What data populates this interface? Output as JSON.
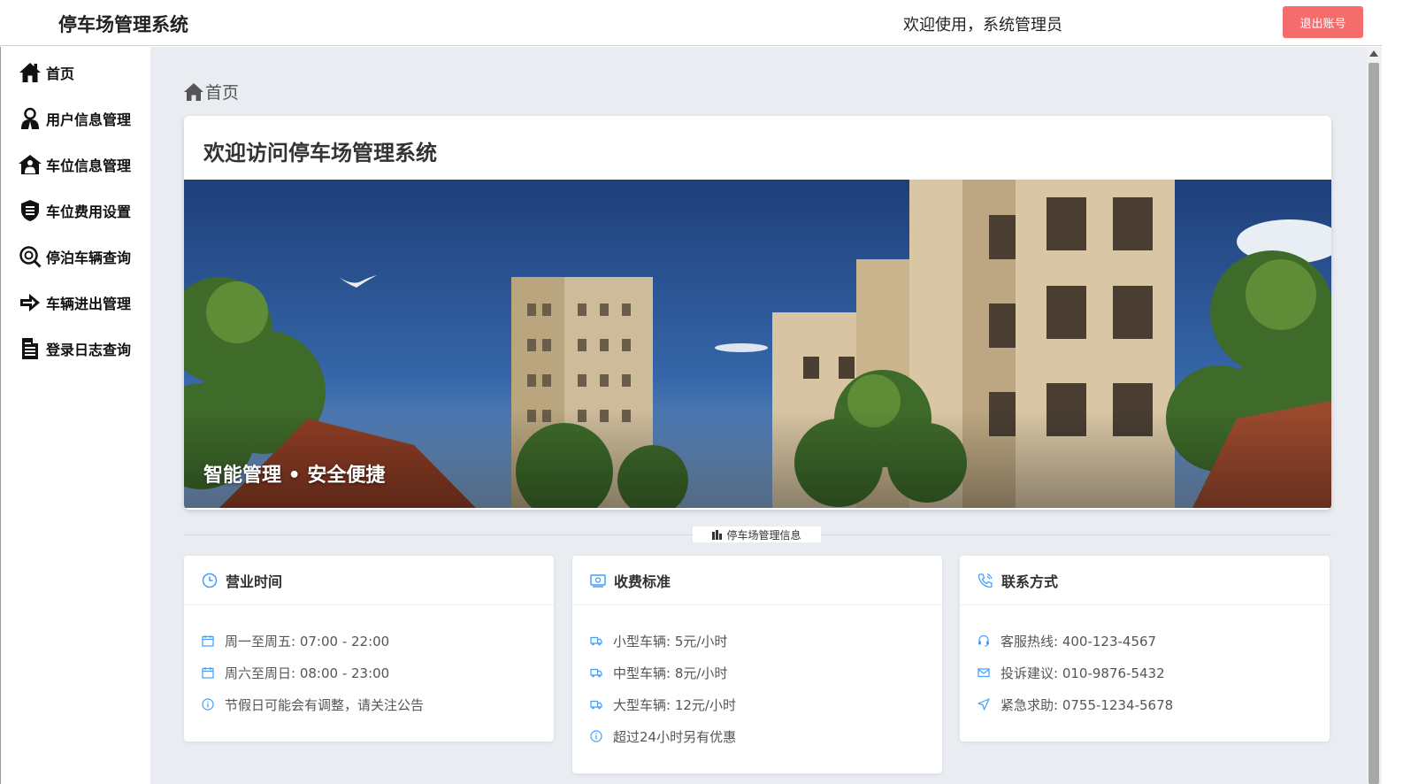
{
  "header": {
    "title": "停车场管理系统",
    "welcome": "欢迎使用，系统管理员",
    "logout_label": "退出账号",
    "logout_color": "#f56c6c"
  },
  "sidebar": {
    "items": [
      {
        "label": "首页",
        "icon": "home-icon"
      },
      {
        "label": "用户信息管理",
        "icon": "user-icon"
      },
      {
        "label": "车位信息管理",
        "icon": "parking-house-icon"
      },
      {
        "label": "车位费用设置",
        "icon": "fee-shield-icon"
      },
      {
        "label": "停泊车辆查询",
        "icon": "search-icon"
      },
      {
        "label": "车辆进出管理",
        "icon": "arrow-right-icon"
      },
      {
        "label": "登录日志查询",
        "icon": "document-icon"
      }
    ]
  },
  "main": {
    "breadcrumb": "首页",
    "welcome_title": "欢迎访问停车场管理系统",
    "banner_caption": "智能管理 • 安全便捷",
    "divider_label": "停车场管理信息",
    "cards": [
      {
        "title": "营业时间",
        "icon": "clock-icon",
        "rows": [
          {
            "icon": "calendar-icon",
            "text": "周一至周五: 07:00 - 22:00"
          },
          {
            "icon": "calendar-icon",
            "text": "周六至周日: 08:00 - 23:00"
          },
          {
            "icon": "info-icon",
            "text": "节假日可能会有调整，请关注公告"
          }
        ]
      },
      {
        "title": "收费标准",
        "icon": "money-icon",
        "rows": [
          {
            "icon": "truck-icon",
            "text": "小型车辆: 5元/小时"
          },
          {
            "icon": "truck-icon",
            "text": "中型车辆: 8元/小时"
          },
          {
            "icon": "truck-icon",
            "text": "大型车辆: 12元/小时"
          },
          {
            "icon": "info-icon",
            "text": "超过24小时另有优惠"
          }
        ]
      },
      {
        "title": "联系方式",
        "icon": "phone-icon",
        "rows": [
          {
            "icon": "headset-icon",
            "text": "客服热线: 400-123-4567"
          },
          {
            "icon": "mail-icon",
            "text": "投诉建议: 010-9876-5432"
          },
          {
            "icon": "location-icon",
            "text": "紧急求助: 0755-1234-5678"
          }
        ]
      }
    ],
    "accent_color": "#409eff"
  }
}
